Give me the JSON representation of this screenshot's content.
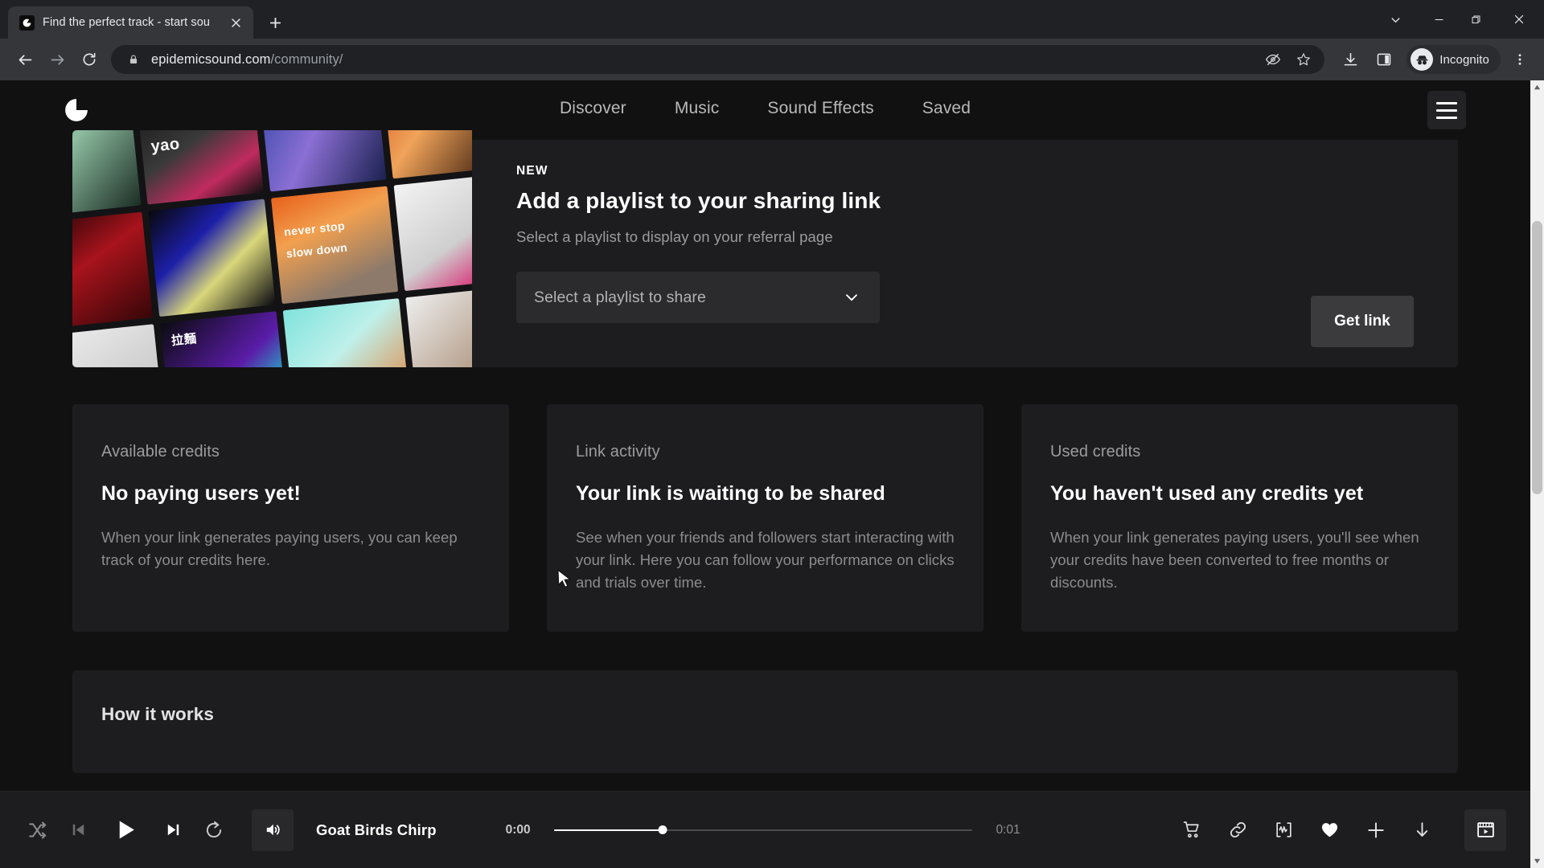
{
  "browser": {
    "tab": {
      "title": "Find the perfect track - start sou",
      "favicon_icon": "epidemic-sound-logo-icon",
      "close_icon": "close-icon"
    },
    "new_tab_icon": "plus-icon",
    "window_controls": {
      "chevron_icon": "chevron-down-icon",
      "minimize_icon": "minimize-icon",
      "maximize_icon": "restore-icon",
      "close_icon": "close-icon"
    },
    "toolbar": {
      "back_icon": "back-arrow-icon",
      "forward_icon": "forward-arrow-icon",
      "reload_icon": "reload-icon",
      "lock_icon": "lock-icon",
      "url_domain": "epidemicsound.com",
      "url_path": "/community/",
      "third_party_cookie_icon": "eye-slash-icon",
      "bookmark_icon": "star-icon",
      "download_icon": "download-icon",
      "side_panel_icon": "side-panel-icon",
      "profile_label": "Incognito",
      "profile_icon": "incognito-hat-icon",
      "menu_icon": "three-dots-icon"
    }
  },
  "site": {
    "logo_icon": "epidemic-sound-logo-icon",
    "nav": [
      {
        "label": "Discover"
      },
      {
        "label": "Music"
      },
      {
        "label": "Sound Effects"
      },
      {
        "label": "Saved"
      }
    ],
    "menu_button_icon": "hamburger-menu-icon"
  },
  "promo": {
    "badge": "NEW",
    "title": "Add a playlist to your sharing link",
    "subtitle": "Select a playlist to display on your referral page",
    "select_value": "Select a playlist to share",
    "select_chevron_icon": "chevron-down-icon",
    "get_link_label": "Get link",
    "artwork_labels": [
      "yao",
      "never stop",
      "slow down",
      "拉麵"
    ]
  },
  "cards": [
    {
      "kicker": "Available credits",
      "title": "No paying users yet!",
      "body": "When your link generates paying users, you can keep track of your credits here."
    },
    {
      "kicker": "Link activity",
      "title": "Your link is waiting to be shared",
      "body": "See when your friends and followers start interacting with your link. Here you can follow your performance on clicks and trials over time."
    },
    {
      "kicker": "Used credits",
      "title": "You haven't used any credits yet",
      "body": "When your link generates paying users, you'll see when your credits have been converted to free months or discounts."
    }
  ],
  "how_it_works": {
    "title": "How it works"
  },
  "player": {
    "shuffle_icon": "shuffle-icon",
    "previous_icon": "previous-track-icon",
    "play_icon": "play-icon",
    "next_icon": "next-track-icon",
    "repeat_icon": "repeat-icon",
    "volume_icon": "volume-icon",
    "track_title": "Goat Birds Chirp",
    "time_current": "0:00",
    "time_total": "0:01",
    "progress_percent": 26,
    "actions": [
      {
        "icon": "cart-icon"
      },
      {
        "icon": "link-icon"
      },
      {
        "icon": "waveform-icon"
      },
      {
        "icon": "heart-icon"
      },
      {
        "icon": "plus-icon"
      },
      {
        "icon": "download-arrow-icon"
      }
    ],
    "video_icon": "video-player-icon"
  },
  "colors": {
    "browser_chrome": "#202124",
    "browser_toolbar": "#35363a",
    "page_bg": "#111112",
    "card_bg": "#1d1d1f",
    "text_primary": "#ffffff",
    "text_muted": "#9c9c9f"
  }
}
